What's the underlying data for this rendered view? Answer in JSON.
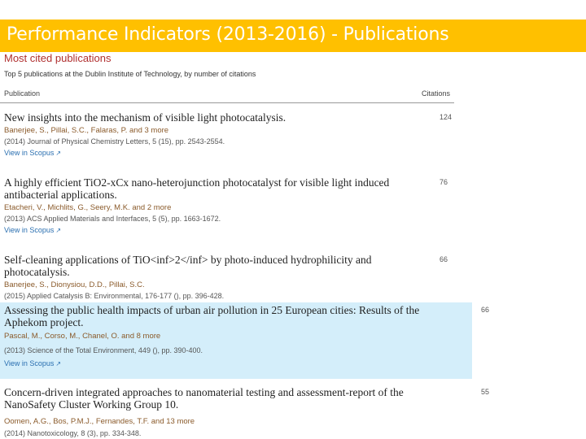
{
  "banner": {
    "title": "Performance Indicators (2013-2016) - Publications"
  },
  "widget": {
    "title": "Most cited publications",
    "subtitle": "Top 5 publications at the Dublin Institute of Technology, by number of citations",
    "col_publication": "Publication",
    "col_citations": "Citations"
  },
  "publications": [
    {
      "title": "New insights into the mechanism of visible light photocatalysis.",
      "citations": "124",
      "authors": "Banerjee, S., Pillai, S.C., Falaras, P. and 3 more",
      "source": "(2014) Journal of Physical Chemistry Letters, 5 (15), pp. 2543-2554.",
      "link": "View in Scopus",
      "link_icon": "external-link-icon"
    },
    {
      "title": "A highly efficient TiO2-xCx nano-heterojunction photocatalyst for visible light induced antibacterial applications.",
      "citations": "76",
      "authors": "Etacheri, V., Michlits, G., Seery, M.K. and 2 more",
      "source": "(2013) ACS Applied Materials and Interfaces, 5 (5), pp. 1663-1672.",
      "link": "View in Scopus",
      "link_icon": "external-link-icon"
    },
    {
      "title": "Self-cleaning applications of TiO<inf>2</inf> by photo-induced hydrophilicity and photocatalysis.",
      "citations": "66",
      "authors": "Banerjee, S., Dionysiou, D.D., Pillai, S.C.",
      "source": "(2015) Applied Catalysis B: Environmental, 176-177 (), pp. 396-428.",
      "link": "",
      "link_icon": ""
    },
    {
      "title": "Assessing the public health impacts of urban air pollution in 25 European cities: Results of the Aphekom project.",
      "citations": "66",
      "authors": "Pascal, M., Corso, M., Chanel, O. and 8 more",
      "source": "(2013) Science of the Total Environment, 449 (), pp. 390-400.",
      "link": "View in Scopus",
      "link_icon": "external-link-icon"
    },
    {
      "title": "Concern-driven integrated approaches to nanomaterial testing and assessment-report of the NanoSafety Cluster Working Group 10.",
      "citations": "55",
      "authors": "Oomen, A.G., Bos, P.M.J., Fernandes, T.F. and 13 more",
      "source": "(2014) Nanotoxicology, 8 (3), pp. 334-348.",
      "link": "",
      "link_icon": ""
    }
  ]
}
